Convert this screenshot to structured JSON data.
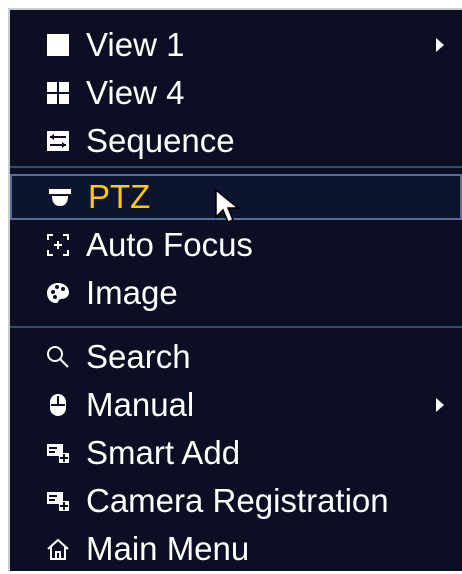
{
  "menu": {
    "groups": [
      [
        {
          "label": "View 1",
          "icon": "square-icon",
          "submenu": true
        },
        {
          "label": "View 4",
          "icon": "grid-four-icon",
          "submenu": false
        },
        {
          "label": "Sequence",
          "icon": "sequence-icon",
          "submenu": false
        }
      ],
      [
        {
          "label": "PTZ",
          "icon": "dome-camera-icon",
          "submenu": false,
          "active": true
        },
        {
          "label": "Auto Focus",
          "icon": "focus-icon",
          "submenu": false
        },
        {
          "label": "Image",
          "icon": "palette-icon",
          "submenu": false
        }
      ],
      [
        {
          "label": "Search",
          "icon": "search-icon",
          "submenu": false
        },
        {
          "label": "Manual",
          "icon": "mouse-icon",
          "submenu": true
        },
        {
          "label": "Smart Add",
          "icon": "smart-add-icon",
          "submenu": false
        },
        {
          "label": "Camera Registration",
          "icon": "camera-registration-icon",
          "submenu": false
        },
        {
          "label": "Main Menu",
          "icon": "home-icon",
          "submenu": false
        }
      ]
    ]
  },
  "colors": {
    "background": "#0c0f23",
    "text": "#ffffff",
    "active_text": "#ffcc00",
    "active_border": "#5b6e97",
    "divider": "#3c4a64"
  }
}
